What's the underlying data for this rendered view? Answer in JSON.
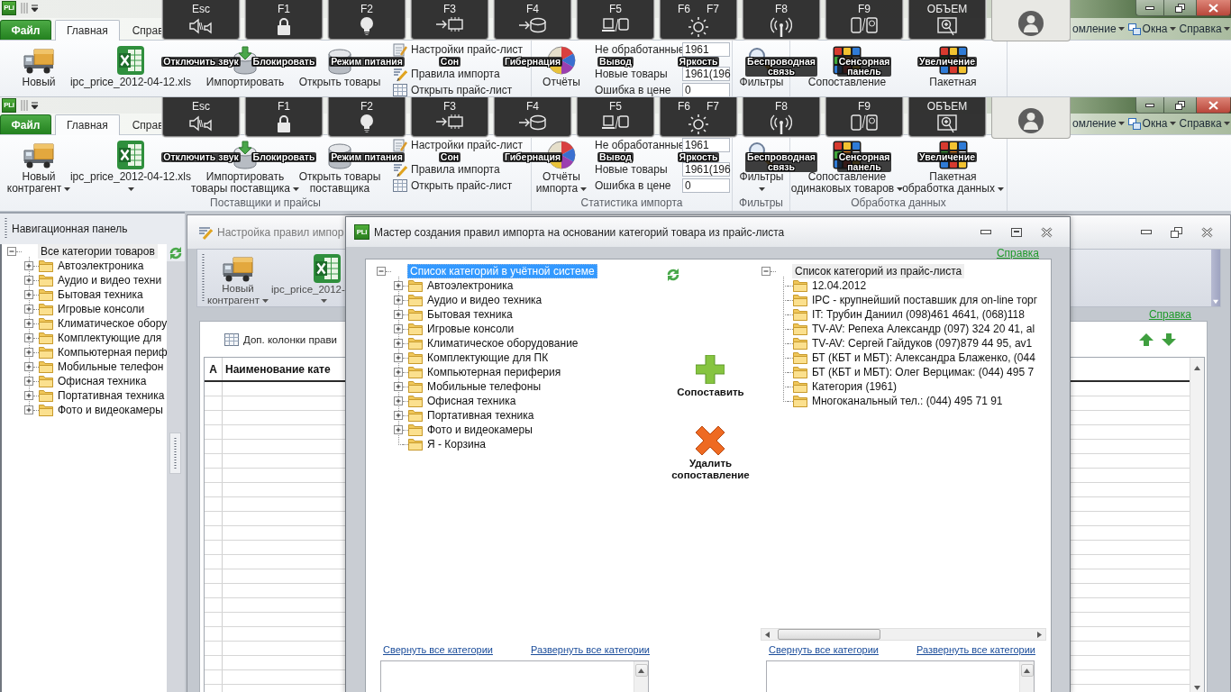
{
  "ribbon_copies": [
    {
      "logo": "PLi",
      "tabs": [
        {
          "label": "Файл",
          "kind": "file",
          "selected": false
        },
        {
          "label": "Главная",
          "kind": "tab",
          "selected": true
        },
        {
          "label": "Справ",
          "kind": "tab",
          "selected": false
        }
      ],
      "menus": [
        {
          "label": "омление"
        },
        {
          "label": "Окна"
        },
        {
          "label": "Справка"
        }
      ],
      "groups": [
        {
          "large_buttons": [
            {
              "lines": [
                "Новый"
              ],
              "dropdown": false
            },
            {
              "lines": [
                "ipc_price_2012-04-12.xls"
              ],
              "dropdown": false
            },
            {
              "lines": [
                "Импортировать"
              ],
              "dropdown": false
            },
            {
              "lines": [
                "Открыть товары"
              ],
              "dropdown": false
            }
          ],
          "small_buttons": [
            "Настройки прайс-лист",
            "Правила импорта",
            "Открыть прайс-лист"
          ]
        },
        {
          "large_buttons": [
            {
              "lines": [
                "Отчёты"
              ],
              "dropdown": false
            }
          ],
          "stats": [
            {
              "label": "Не обработанные",
              "value": "1961"
            },
            {
              "label": "Новые товары",
              "value": "1961(196"
            },
            {
              "label": "Ошибка в цене",
              "value": "0"
            }
          ]
        },
        {
          "large_buttons": [
            {
              "lines": [
                "Фильтры"
              ],
              "dropdown": false
            }
          ]
        },
        {
          "large_buttons": [
            {
              "lines": [
                "Сопоставление"
              ],
              "dropdown": false
            },
            {
              "lines": [
                "Пакетная"
              ],
              "dropdown": false
            }
          ]
        }
      ],
      "key_overlay": [
        {
          "kind": "key",
          "keys": [
            "Esc"
          ],
          "caption": [
            "Отключить звук"
          ]
        },
        {
          "kind": "key",
          "keys": [
            "F1"
          ],
          "caption": [
            "Блокировать"
          ]
        },
        {
          "kind": "key",
          "keys": [
            "F2"
          ],
          "caption": [
            "Режим питания"
          ]
        },
        {
          "kind": "key",
          "keys": [
            "F3"
          ],
          "caption": [
            "Сон"
          ]
        },
        {
          "kind": "key",
          "keys": [
            "F4"
          ],
          "caption": [
            "Гибернация"
          ]
        },
        {
          "kind": "key",
          "keys": [
            "F5"
          ],
          "caption": [
            "Вывод"
          ]
        },
        {
          "kind": "key",
          "keys": [
            "F6",
            "F7"
          ],
          "caption": [
            "Яркость"
          ]
        },
        {
          "kind": "key",
          "keys": [
            "F8"
          ],
          "caption": [
            "Беспроводная",
            "связь"
          ]
        },
        {
          "kind": "key",
          "keys": [
            "F9"
          ],
          "caption": [
            "Сенсорная",
            "панель"
          ]
        },
        {
          "kind": "key",
          "keys": [
            "ОБЪЕМ"
          ],
          "caption": [
            "Увеличение"
          ]
        },
        {
          "kind": "account"
        }
      ]
    },
    {
      "logo": "PLi",
      "tabs": [
        {
          "label": "Файл",
          "kind": "file",
          "selected": false
        },
        {
          "label": "Главная",
          "kind": "tab",
          "selected": true
        },
        {
          "label": "Справ",
          "kind": "tab",
          "selected": false
        }
      ],
      "menus": [
        {
          "label": "омление"
        },
        {
          "label": "Окна"
        },
        {
          "label": "Справка"
        }
      ],
      "groups": [
        {
          "label": "Поставщики и прайсы",
          "large_buttons": [
            {
              "lines": [
                "Новый",
                "контрагент"
              ],
              "dropdown": true
            },
            {
              "lines": [
                "ipc_price_2012-04-12.xls"
              ],
              "dropdown": true
            },
            {
              "lines": [
                "Импортировать",
                "товары поставщика"
              ],
              "dropdown": true
            },
            {
              "lines": [
                "Открыть товары",
                "поставщика"
              ],
              "dropdown": false
            }
          ],
          "small_buttons": [
            "Настройки прайс-лист",
            "Правила импорта",
            "Открыть прайс-лист"
          ]
        },
        {
          "label": "Статистика импорта",
          "large_buttons": [
            {
              "lines": [
                "Отчёты",
                "импорта"
              ],
              "dropdown": true
            }
          ],
          "stats": [
            {
              "label": "Не обработанные",
              "value": "1961"
            },
            {
              "label": "Новые товары",
              "value": "1961(196"
            },
            {
              "label": "Ошибка в цене",
              "value": "0"
            }
          ]
        },
        {
          "label": "Фильтры",
          "large_buttons": [
            {
              "lines": [
                "Фильтры"
              ],
              "dropdown": true
            }
          ]
        },
        {
          "label": "Обработка данных",
          "large_buttons": [
            {
              "lines": [
                "Сопоставление",
                "одинаковых товаров"
              ],
              "dropdown": true
            },
            {
              "lines": [
                "Пакетная",
                "обработка данных"
              ],
              "dropdown": true
            }
          ]
        }
      ],
      "key_overlay": [
        {
          "kind": "key",
          "keys": [
            "Esc"
          ],
          "caption": [
            "Отключить звук"
          ]
        },
        {
          "kind": "key",
          "keys": [
            "F1"
          ],
          "caption": [
            "Блокировать"
          ]
        },
        {
          "kind": "key",
          "keys": [
            "F2"
          ],
          "caption": [
            "Режим питания"
          ]
        },
        {
          "kind": "key",
          "keys": [
            "F3"
          ],
          "caption": [
            "Сон"
          ]
        },
        {
          "kind": "key",
          "keys": [
            "F4"
          ],
          "caption": [
            "Гибернация"
          ]
        },
        {
          "kind": "key",
          "keys": [
            "F5"
          ],
          "caption": [
            "Вывод"
          ]
        },
        {
          "kind": "key",
          "keys": [
            "F6",
            "F7"
          ],
          "caption": [
            "Яркость"
          ]
        },
        {
          "kind": "key",
          "keys": [
            "F8"
          ],
          "caption": [
            "Беспроводная",
            "связь"
          ]
        },
        {
          "kind": "key",
          "keys": [
            "F9"
          ],
          "caption": [
            "Сенсорная",
            "панель"
          ]
        },
        {
          "kind": "key",
          "keys": [
            "ОБЪЕМ"
          ],
          "caption": [
            "Увеличение"
          ]
        },
        {
          "kind": "account"
        }
      ]
    }
  ],
  "navigation_panel": {
    "title": "Навигационная панель",
    "tree": {
      "focused": false,
      "root": {
        "label": "Все категории товаров",
        "kind": "branch",
        "expanded": true,
        "selected": true,
        "children": [
          {
            "label": "Автоэлектроника",
            "kind": "branch",
            "expanded": false,
            "selected": false
          },
          {
            "label": "Аудио и видео техни",
            "kind": "branch",
            "expanded": false,
            "selected": false
          },
          {
            "label": "Бытовая техника",
            "kind": "branch",
            "expanded": false,
            "selected": false
          },
          {
            "label": "Игровые консоли",
            "kind": "branch",
            "expanded": false,
            "selected": false
          },
          {
            "label": "Климатическое обору",
            "kind": "branch",
            "expanded": false,
            "selected": false
          },
          {
            "label": "Комплектующие для",
            "kind": "branch",
            "expanded": false,
            "selected": false
          },
          {
            "label": "Компьютерная периф",
            "kind": "branch",
            "expanded": false,
            "selected": false
          },
          {
            "label": "Мобильные телефон",
            "kind": "branch",
            "expanded": false,
            "selected": false
          },
          {
            "label": "Офисная техника",
            "kind": "branch",
            "expanded": false,
            "selected": false
          },
          {
            "label": "Портативная техника",
            "kind": "branch",
            "expanded": false,
            "selected": false
          },
          {
            "label": "Фото и видеокамеры",
            "kind": "branch",
            "expanded": false,
            "selected": false
          }
        ]
      }
    }
  },
  "background_window": {
    "title": "Настройка правил импор",
    "toolbar": [
      {
        "lines": [
          "Новый",
          "контрагент"
        ],
        "dropdown": true
      },
      {
        "lines": [
          "ipc_price_2012-"
        ],
        "dropdown": true
      }
    ],
    "help_link": "Справка",
    "grid_caption": "Доп. колонки прави",
    "grid_columns": [
      "А",
      "Наименование кате"
    ]
  },
  "dialog": {
    "logo": "PLi",
    "title": "Мастер создания правил импорта на основании категорий товара из прайс-листа",
    "help_link": "Справка",
    "left_tree": {
      "focused": true,
      "root": {
        "label": "Список категорий в учётной системе",
        "kind": "branch",
        "expanded": true,
        "selected": true,
        "children": [
          {
            "label": "Автоэлектроника",
            "kind": "branch",
            "expanded": false,
            "selected": false
          },
          {
            "label": "Аудио и видео техника",
            "kind": "branch",
            "expanded": false,
            "selected": false
          },
          {
            "label": "Бытовая техника",
            "kind": "branch",
            "expanded": false,
            "selected": false
          },
          {
            "label": "Игровые консоли",
            "kind": "branch",
            "expanded": false,
            "selected": false
          },
          {
            "label": "Климатическое оборудование",
            "kind": "branch",
            "expanded": false,
            "selected": false
          },
          {
            "label": "Комплектующие для ПК",
            "kind": "branch",
            "expanded": false,
            "selected": false
          },
          {
            "label": "Компьютерная периферия",
            "kind": "branch",
            "expanded": false,
            "selected": false
          },
          {
            "label": "Мобильные телефоны",
            "kind": "branch",
            "expanded": false,
            "selected": false
          },
          {
            "label": "Офисная техника",
            "kind": "branch",
            "expanded": false,
            "selected": false
          },
          {
            "label": "Портативная техника",
            "kind": "branch",
            "expanded": false,
            "selected": false
          },
          {
            "label": "Фото и видеокамеры",
            "kind": "branch",
            "expanded": false,
            "selected": false
          },
          {
            "label": "Я - Корзина",
            "kind": "leaf",
            "selected": false
          }
        ]
      }
    },
    "actions": [
      {
        "kind": "match",
        "lines": [
          "Сопоставить"
        ]
      },
      {
        "kind": "unmatch",
        "lines": [
          "Удалить",
          "сопоставление"
        ]
      }
    ],
    "right_tree": {
      "focused": false,
      "root": {
        "label": "Список категорий из прайс-листа",
        "kind": "branch",
        "expanded": true,
        "selected": true,
        "children": [
          {
            "label": "12.04.2012",
            "kind": "leaf",
            "selected": false
          },
          {
            "label": "IPC - крупнейший поставшик для on-line торг",
            "kind": "leaf",
            "selected": false
          },
          {
            "label": "IT: Трубин Даниил (098)461 4641, (068)118",
            "kind": "leaf",
            "selected": false
          },
          {
            "label": "TV-AV: Репеха Александр (097) 324 20 41, al",
            "kind": "leaf",
            "selected": false
          },
          {
            "label": "TV-AV: Сергей Гайдуков (097)879 44 95, av1",
            "kind": "leaf",
            "selected": false
          },
          {
            "label": "БТ (КБТ и МБТ): Александра Блаженко, (044",
            "kind": "leaf",
            "selected": false
          },
          {
            "label": "БТ (КБТ и МБТ): Олег Верцимак: (044) 495 7",
            "kind": "leaf",
            "selected": false
          },
          {
            "label": "Категория (1961)",
            "kind": "leaf",
            "selected": false
          },
          {
            "label": "Многоканальный тел.: (044) 495 71 91",
            "kind": "leaf",
            "selected": false
          }
        ]
      }
    },
    "left_links": [
      "Свернуть все категории",
      "Развернуть все категории"
    ],
    "right_links": [
      "Свернуть все категории",
      "Развернуть все категории"
    ]
  }
}
